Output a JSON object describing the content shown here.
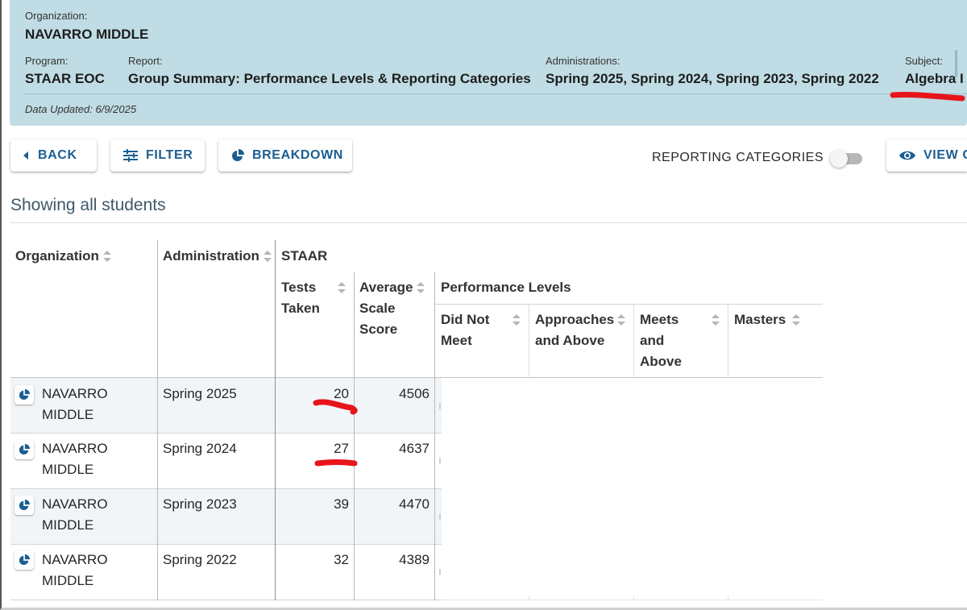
{
  "header": {
    "organization_label": "Organization:",
    "organization_value": "NAVARRO MIDDLE",
    "program_label": "Program:",
    "program_value": "STAAR EOC",
    "report_label": "Report:",
    "report_value": "Group Summary: Performance Levels & Reporting Categories",
    "administrations_label": "Administrations:",
    "administrations_value": "Spring 2025, Spring 2024, Spring 2023, Spring 2022",
    "subject_label": "Subject:",
    "subject_value": "Algebra I",
    "data_updated": "Data Updated: 6/9/2025"
  },
  "toolbar": {
    "back_label": "BACK",
    "filter_label": "FILTER",
    "breakdown_label": "BREAKDOWN",
    "reporting_categories_label": "REPORTING CATEGORIES",
    "reporting_categories_on": false,
    "view_label": "VIEW C"
  },
  "showing_text": "Showing all students",
  "table": {
    "headers": {
      "organization": "Organization",
      "administration": "Administration",
      "staar": "STAAR",
      "tests_taken_1": "Tests",
      "tests_taken_2": "Taken",
      "avg_1": "Average",
      "avg_2": "Scale",
      "avg_3": "Score",
      "performance_levels": "Performance Levels",
      "did_not_meet_1": "Did Not",
      "did_not_meet_2": "Meet",
      "approaches_1": "Approaches",
      "approaches_2": "and Above",
      "meets_1": "Meets",
      "meets_2": "and",
      "meets_3": "Above",
      "masters": "Masters"
    },
    "rows": [
      {
        "org_1": "NAVARRO",
        "org_2": "MIDDLE",
        "administration": "Spring 2025",
        "tests_taken": "20",
        "avg_scale_score": "4506"
      },
      {
        "org_1": "NAVARRO",
        "org_2": "MIDDLE",
        "administration": "Spring 2024",
        "tests_taken": "27",
        "avg_scale_score": "4637"
      },
      {
        "org_1": "NAVARRO",
        "org_2": "MIDDLE",
        "administration": "Spring 2023",
        "tests_taken": "39",
        "avg_scale_score": "4470"
      },
      {
        "org_1": "NAVARRO",
        "org_2": "MIDDLE",
        "administration": "Spring 2022",
        "tests_taken": "32",
        "avg_scale_score": "4389"
      }
    ]
  },
  "colors": {
    "header_bg": "#c0dce4",
    "accent_blue": "#1b5e91",
    "annotation_red": "#e8141b",
    "row_alt_bg": "#f1f5f8"
  },
  "icons": {
    "back": "triangle-left-icon",
    "filter": "sliders-icon",
    "breakdown": "pie-chart-icon",
    "view": "eye-icon",
    "sort": "sort-arrows-icon"
  }
}
